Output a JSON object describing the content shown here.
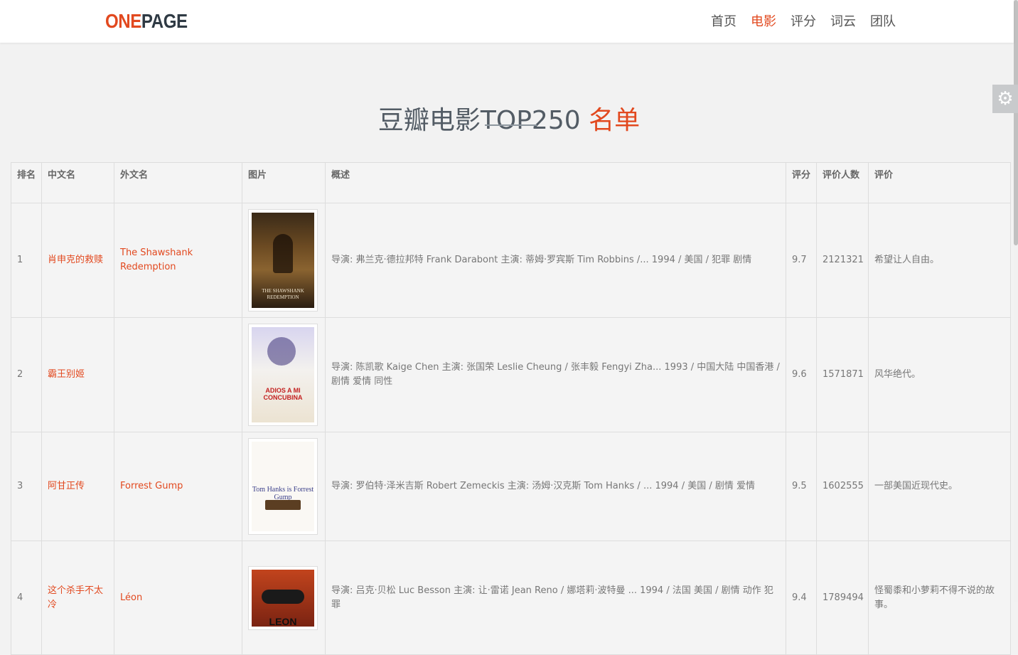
{
  "brand": {
    "logo_part1": "ONE",
    "logo_part2": "PAGE"
  },
  "nav": {
    "items": [
      {
        "label": "首页",
        "active": false
      },
      {
        "label": "电影",
        "active": true
      },
      {
        "label": "评分",
        "active": false
      },
      {
        "label": "词云",
        "active": false
      },
      {
        "label": "团队",
        "active": false
      }
    ]
  },
  "settings_icon": "gear-icon",
  "heading": {
    "main": "豆瓣电影TOP250",
    "highlight": "名单"
  },
  "colors": {
    "accent": "#e2491f",
    "heading": "#535c65"
  },
  "table": {
    "headers": {
      "rank": "排名",
      "cn_name": "中文名",
      "foreign_name": "外文名",
      "image": "图片",
      "summary": "概述",
      "score": "评分",
      "votes": "评价人数",
      "comment": "评价"
    },
    "rows": [
      {
        "rank": "1",
        "cn_name": "肖申克的救赎",
        "foreign_name": "The Shawshank Redemption",
        "poster_caption": "THE SHAWSHANK REDEMPTION",
        "summary": "导演: 弗兰克·德拉邦特 Frank Darabont   主演: 蒂姆·罗宾斯 Tim Robbins /... 1994 / 美国 / 犯罪 剧情",
        "score": "9.7",
        "votes": "2121321",
        "comment": "希望让人自由。"
      },
      {
        "rank": "2",
        "cn_name": "霸王别姬",
        "foreign_name": "",
        "poster_caption": "ADIOS A MI CONCUBINA",
        "summary": "导演: 陈凯歌 Kaige Chen   主演: 张国荣 Leslie Cheung / 张丰毅 Fengyi Zha... 1993 / 中国大陆 中国香港 / 剧情 爱情 同性",
        "score": "9.6",
        "votes": "1571871",
        "comment": "风华绝代。"
      },
      {
        "rank": "3",
        "cn_name": "阿甘正传",
        "foreign_name": "Forrest Gump",
        "poster_caption": "Tom Hanks is Forrest Gump",
        "summary": "导演: 罗伯特·泽米吉斯 Robert Zemeckis   主演: 汤姆·汉克斯 Tom Hanks / ... 1994 / 美国 / 剧情 爱情",
        "score": "9.5",
        "votes": "1602555",
        "comment": "一部美国近现代史。"
      },
      {
        "rank": "4",
        "cn_name": "这个杀手不太冷",
        "foreign_name": "Léon",
        "poster_caption": "LEON",
        "summary": "导演: 吕克·贝松 Luc Besson   主演: 让·雷诺 Jean Reno / 娜塔莉·波特曼 ... 1994 / 法国 美国 / 剧情 动作 犯罪",
        "score": "9.4",
        "votes": "1789494",
        "comment": "怪蜀黍和小萝莉不得不说的故事。"
      }
    ]
  }
}
